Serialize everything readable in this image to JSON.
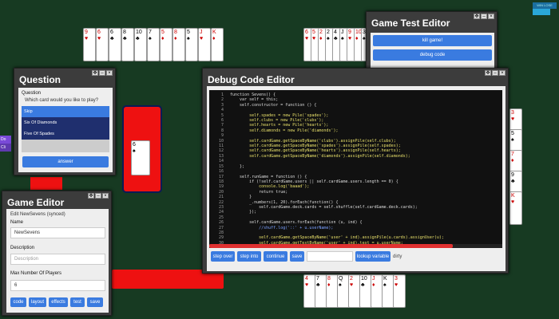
{
  "top_right_label": "WIN LOSE",
  "side_labels": [
    "Do",
    "Cli"
  ],
  "question": {
    "title": "Question",
    "heading": "Question",
    "prompt": "Which card would you like to play?",
    "options": [
      "Skip",
      "Six Of Diamonds",
      "Five Of Spades"
    ],
    "answer_label": "answer"
  },
  "game_editor": {
    "title": "Game Editor",
    "subtitle": "Edit NewSevens (synced)",
    "name_label": "Name",
    "name_value": "NewSevens",
    "description_label": "Description",
    "description_placeholder": "Description",
    "max_players_label": "Max Number Of Players",
    "max_players_value": "6",
    "buttons": [
      "code",
      "layout",
      "effects",
      "test",
      "save"
    ]
  },
  "game_test_editor": {
    "title": "Game Test Editor",
    "buttons": [
      "kill game!",
      "debug code"
    ]
  },
  "debug_editor": {
    "title": "Debug Code Editor",
    "line_numbers": [
      "1",
      "2",
      "3",
      "4",
      "5",
      "6",
      "7",
      "8",
      "9",
      "10",
      "11",
      "12",
      "13",
      "14",
      "15",
      "16",
      "17",
      "18",
      "19",
      "20",
      "21",
      "22",
      "23",
      "24",
      "25",
      "26",
      "27",
      "28",
      "29",
      "30",
      "31"
    ],
    "code_lines": [
      "function Sevens() {",
      "    var self = this;",
      "    self.constructor = function () {",
      "",
      "        self.spades = new Pile('spades');",
      "        self.clubs = new Pile('clubs');",
      "        self.hearts = new Pile('hearts');",
      "        self.diamonds = new Pile('diamonds');",
      "",
      "        self.cardGame.getSpaceByName('clubs').assignPile(self.clubs);",
      "        self.cardGame.getSpaceByName('spades').assignPile(self.spades);",
      "        self.cardGame.getSpaceByName('hearts').assignPile(self.hearts);",
      "        self.cardGame.getSpaceByName('diamonds').assignPile(self.diamonds);",
      "",
      "    };",
      "",
      "    self.runGame = function () {",
      "        if (!self.cardGame.users || self.cardGame.users.length == 0) {",
      "            console.log('baaad');",
      "            return true;",
      "        }",
      "        _.numbers(1, 20).forEach(function() {",
      "            self.cardGame.deck.cards = self.shuffle(self.cardGame.deck.cards);",
      "        });",
      "",
      "        self.cardGame.users.forEach(function (u, ind) {",
      "            //shuff.log('::' + u.userName);",
      "",
      "            self.cardGame.getSpaceByName('user' + ind).assignPile(u.cards).assignUser(u);",
      "            self.cardGame.getTextByName('user' + ind).text = u.userName;",
      "        });"
    ],
    "buttons": [
      "step over",
      "step into",
      "continue",
      "save"
    ],
    "input_value": "",
    "lookup_label": "lookup variable",
    "status": "dirty"
  },
  "top_left_cards": [
    {
      "r": "9",
      "s": "♥",
      "c": "red"
    },
    {
      "r": "6",
      "s": "♥",
      "c": "red"
    },
    {
      "r": "6",
      "s": "♣",
      "c": "black"
    },
    {
      "r": "8",
      "s": "♣",
      "c": "black"
    },
    {
      "r": "10",
      "s": "♣",
      "c": "black"
    },
    {
      "r": "7",
      "s": "♠",
      "c": "black"
    },
    {
      "r": "5",
      "s": "♦",
      "c": "red"
    },
    {
      "r": "8",
      "s": "♦",
      "c": "red"
    },
    {
      "r": "5",
      "s": "♠",
      "c": "black"
    },
    {
      "r": "J",
      "s": "♥",
      "c": "red"
    },
    {
      "r": "K",
      "s": "♦",
      "c": "red"
    }
  ],
  "top_mid_cards": [
    {
      "r": "6",
      "s": "♥",
      "c": "red"
    },
    {
      "r": "5",
      "s": "♥",
      "c": "red"
    },
    {
      "r": "2",
      "s": "♦",
      "c": "red"
    },
    {
      "r": "2",
      "s": "♠",
      "c": "black"
    },
    {
      "r": "4",
      "s": "♣",
      "c": "black"
    },
    {
      "r": "J",
      "s": "♠",
      "c": "black"
    },
    {
      "r": "9",
      "s": "♥",
      "c": "red"
    },
    {
      "r": "10",
      "s": "♦",
      "c": "red"
    },
    {
      "r": "3",
      "s": "♠",
      "c": "black"
    }
  ],
  "bottom_cards": [
    {
      "r": "4",
      "s": "♥",
      "c": "red"
    },
    {
      "r": "7",
      "s": "♣",
      "c": "black"
    },
    {
      "r": "8",
      "s": "♦",
      "c": "red"
    },
    {
      "r": "Q",
      "s": "♠",
      "c": "black"
    },
    {
      "r": "2",
      "s": "♥",
      "c": "red"
    },
    {
      "r": "10",
      "s": "♣",
      "c": "black"
    },
    {
      "r": "J",
      "s": "♦",
      "c": "red"
    },
    {
      "r": "K",
      "s": "♠",
      "c": "black"
    },
    {
      "r": "3",
      "s": "♥",
      "c": "red"
    }
  ],
  "right_cards": [
    {
      "r": "3",
      "s": "♥",
      "c": "red"
    },
    {
      "r": "5",
      "s": "♠",
      "c": "black"
    },
    {
      "r": "7",
      "s": "♦",
      "c": "red"
    },
    {
      "r": "9",
      "s": "♣",
      "c": "black"
    },
    {
      "r": "K",
      "s": "♥",
      "c": "red"
    }
  ],
  "pile_card": {
    "r": "6",
    "s": "♠",
    "c": "black"
  },
  "colors": {
    "table": "#173a22",
    "accent": "#3a7be0",
    "space_red": "#ee1111",
    "selection": "#1f2f6e"
  }
}
